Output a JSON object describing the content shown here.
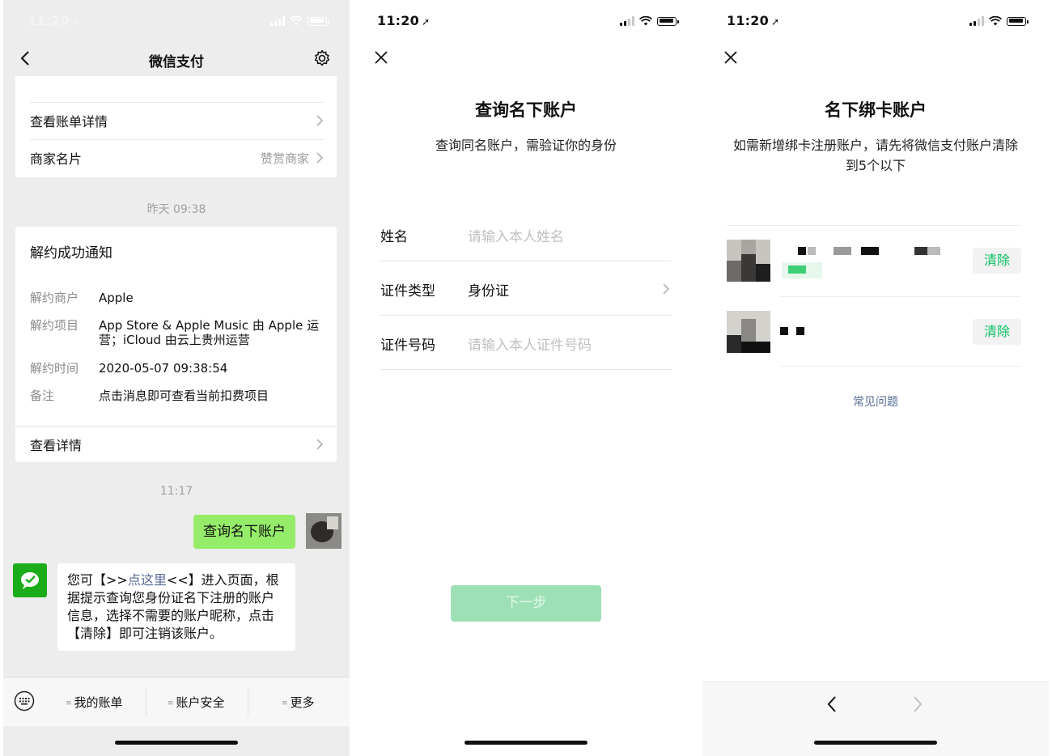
{
  "status": {
    "time": "11:20"
  },
  "screen1": {
    "title": "微信支付",
    "rows": [
      {
        "label": "查看账单详情",
        "value": ""
      },
      {
        "label": "商家名片",
        "value": "赞赏商家"
      }
    ],
    "timestamp1": "昨天 09:38",
    "notice": {
      "title": "解约成功通知",
      "fields": [
        {
          "key": "解约商户",
          "value": "Apple"
        },
        {
          "key": "解约项目",
          "value": "App Store & Apple Music 由 Apple 运营；iCloud 由云上贵州运营"
        },
        {
          "key": "解约时间",
          "value": "2020-05-07 09:38:54"
        },
        {
          "key": "备注",
          "value": "点击消息即可查看当前扣费项目"
        }
      ],
      "detail_label": "查看详情"
    },
    "timestamp2": "11:17",
    "user_message": "查询名下账户",
    "reply": {
      "before": "您可【>>",
      "link": "点这里",
      "after": "<<】进入页面，根据提示查询您身份证名下注册的账户信息，选择不需要的账户昵称，点击【清除】即可注销该账户。"
    },
    "menu": [
      "我的账单",
      "账户安全",
      "更多"
    ]
  },
  "screen2": {
    "title": "查询名下账户",
    "subtitle": "查询同名账户，需验证你的身份",
    "fields": [
      {
        "label": "姓名",
        "placeholder": "请输入本人姓名"
      },
      {
        "label": "证件类型",
        "value": "身份证"
      },
      {
        "label": "证件号码",
        "placeholder": "请输入本人证件号码"
      }
    ],
    "next_button": "下一步"
  },
  "screen3": {
    "title": "名下绑卡账户",
    "subtitle": "如需新增绑卡注册账户，请先将微信支付账户清除到5个以下",
    "accounts": [
      {
        "clear_label": "清除"
      },
      {
        "clear_label": "清除"
      }
    ],
    "faq": "常见问题"
  }
}
